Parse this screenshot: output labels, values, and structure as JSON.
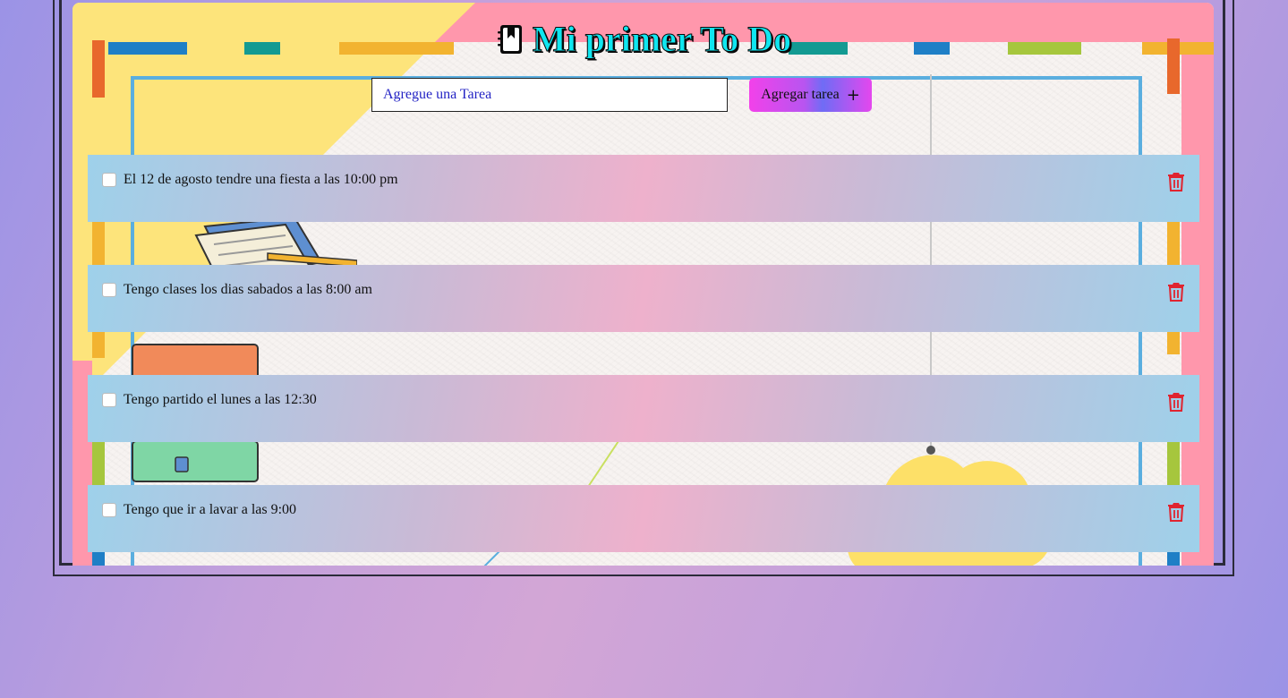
{
  "app": {
    "title": "Mi primer To Do"
  },
  "form": {
    "input_placeholder": "Agregue una Tarea",
    "input_value": "",
    "add_button_label": "Agregar tarea",
    "add_button_icon": "+"
  },
  "tasks": [
    {
      "text": "El 12 de agosto tendre una fiesta a las 10:00 pm",
      "checked": false
    },
    {
      "text": "Tengo clases los dias sabados a las 8:00 am",
      "checked": false
    },
    {
      "text": "Tengo partido el lunes a las 12:30",
      "checked": false
    },
    {
      "text": "Tengo que ir a lavar a las 9:00",
      "checked": false
    }
  ],
  "icons": {
    "title_icon": "address-book-icon",
    "delete_icon": "trash-icon"
  },
  "colors": {
    "title": "#10e6f0",
    "delete_icon": "#e0242f",
    "input_text": "#1b1bcf",
    "button_gradient_start": "#f241ea",
    "button_gradient_end": "#6f6cf5"
  }
}
